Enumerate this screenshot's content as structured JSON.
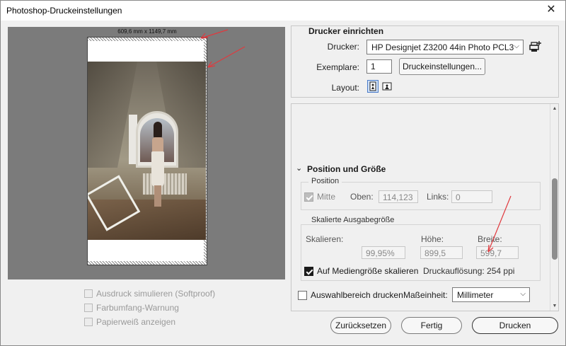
{
  "window": {
    "title": "Photoshop-Druckeinstellungen",
    "close_glyph": "✕"
  },
  "preview": {
    "paper_size": "609,6 mm x 1149,7 mm"
  },
  "softproof": {
    "simulate": "Ausdruck simulieren (Softproof)",
    "gamut": "Farbumfang-Warnung",
    "paper_white": "Papierweiß anzeigen"
  },
  "printer_setup": {
    "heading": "Drucker einrichten",
    "printer_label": "Drucker:",
    "printer_value": "HP Designjet Z3200 44in Photo PCL3",
    "copies_label": "Exemplare:",
    "copies_value": "1",
    "settings_button": "Druckeinstellungen...",
    "layout_label": "Layout:"
  },
  "position_size": {
    "heading": "Position und Größe",
    "position_legend": "Position",
    "center_label": "Mitte",
    "top_label": "Oben:",
    "top_value": "114,123",
    "left_label": "Links:",
    "left_value": "0",
    "scaled_legend": "Skalierte Ausgabegröße",
    "scale_label": "Skalieren:",
    "scale_value": "99,95%",
    "height_label": "Höhe:",
    "height_value": "899,5",
    "width_label": "Breite:",
    "width_value": "599,7",
    "fit_media_label": "Auf Mediengröße skalieren",
    "resolution_text": "Druckauflösung: 254 ppi",
    "print_selection_label": "Auswahlbereich drucken",
    "units_label": "Maßeinheit:",
    "units_value": "Millimeter"
  },
  "footer": {
    "reset": "Zurücksetzen",
    "done": "Fertig",
    "print": "Drucken"
  },
  "colors": {
    "preview_bg": "#7b7b7b",
    "annotation_arrow": "#e0393e"
  },
  "icons": {
    "add_printer": "printer-plus-icon",
    "portrait": "portrait-layout-icon",
    "landscape": "landscape-layout-icon",
    "collapse": "chevron-down-icon",
    "dropdown": "chevron-down-icon"
  }
}
